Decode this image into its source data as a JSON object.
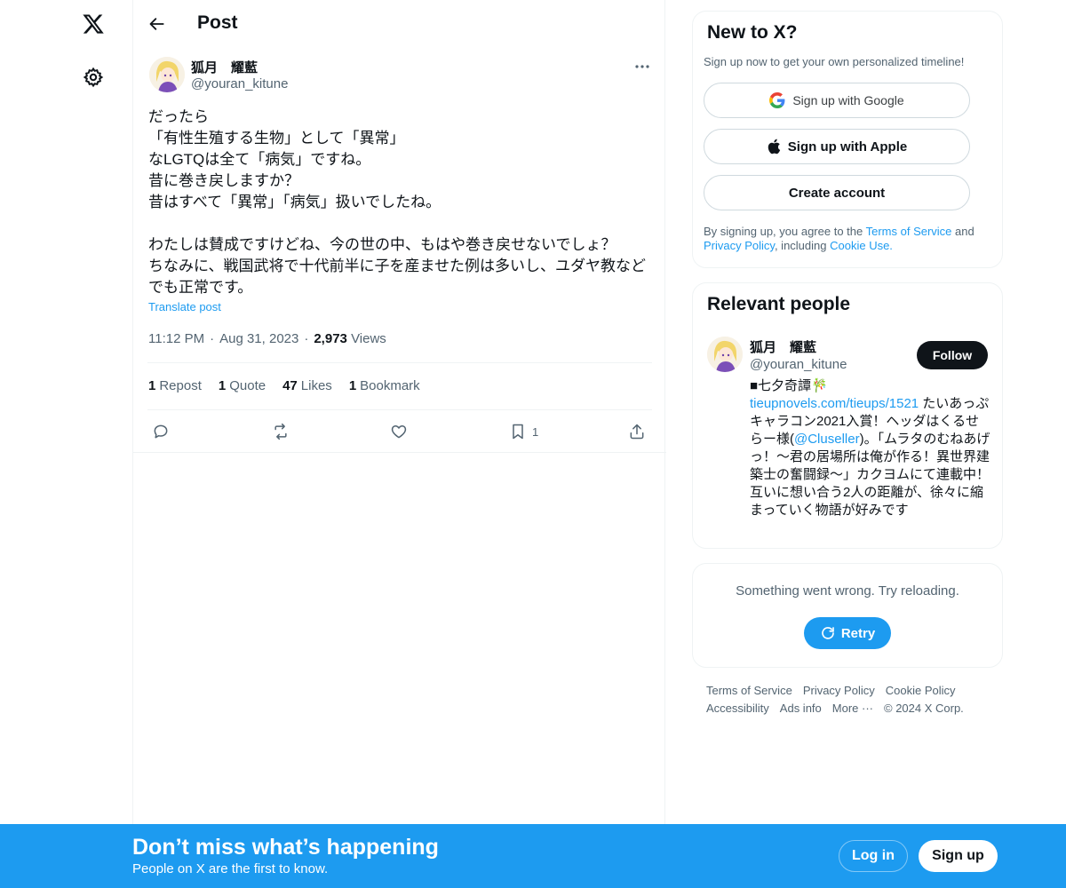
{
  "post": {
    "header_title": "Post",
    "author_name": "狐月　耀藍",
    "author_handle": "@youran_kitune",
    "text": "だったら\n「有性生殖する生物」として「異常」\nなLGTQは全て「病気」ですね。\n昔に巻き戻しますか？\n昔はすべて「異常」「病気」扱いでしたね。\n\nわたしは賛成ですけどね、今の世の中、もはや巻き戻せないでしょ？\nちなみに、戦国武将で十代前半に子を産ませた例は多いし、ユダヤ教などでも正常です。",
    "translate_label": "Translate post",
    "time": "11:12 PM",
    "date": "Aug 31, 2023",
    "views_count": "2,973",
    "views_label": "Views",
    "stats": {
      "reposts_count": "1",
      "reposts_label": "Repost",
      "quotes_count": "1",
      "quotes_label": "Quote",
      "likes_count": "47",
      "likes_label": "Likes",
      "bookmarks_count": "1",
      "bookmarks_label": "Bookmark"
    },
    "bookmark_action_count": "1"
  },
  "signup_card": {
    "title": "New to X?",
    "subtitle": "Sign up now to get your own personalized timeline!",
    "google_label": "Sign up with Google",
    "apple_label": "Sign up with Apple",
    "create_label": "Create account",
    "legal_prefix": "By signing up, you agree to the ",
    "terms_link": "Terms of Service",
    "legal_and": " and ",
    "privacy_link": "Privacy Policy",
    "legal_including": ", including ",
    "cookie_link": "Cookie Use."
  },
  "relevant_people": {
    "title": "Relevant people",
    "name": "狐月　耀藍",
    "handle": "@youran_kitune",
    "follow_label": "Follow",
    "bio_part1": "■七夕奇譚🎋 ",
    "bio_link1": "tieupnovels.com/tieups/1521",
    "bio_part2": " たいあっぷキャラコン2021入賞！ヘッダはくるせらー様(",
    "bio_link2": "@Cluseller",
    "bio_part3": ")。「ムラタのむねあげっ！～君の居場所は俺が作る！異世界建築士の奮闘録～」カクヨムにて連載中！ 互いに想い合う2人の距離が、徐々に縮まっていく物語が好みです"
  },
  "error_card": {
    "message": "Something went wrong. Try reloading.",
    "retry_label": "Retry"
  },
  "footer": {
    "terms": "Terms of Service",
    "privacy": "Privacy Policy",
    "cookie": "Cookie Policy",
    "accessibility": "Accessibility",
    "ads_info": "Ads info",
    "more": "More ···",
    "copyright": "© 2024 X Corp."
  },
  "banner": {
    "title": "Don’t miss what’s happening",
    "subtitle": "People on X are the first to know.",
    "login_label": "Log in",
    "signup_label": "Sign up"
  },
  "colors": {
    "accent": "#1d9bf0",
    "text_primary": "#0f1419",
    "text_secondary": "#536471",
    "border": "#eff3f4"
  }
}
